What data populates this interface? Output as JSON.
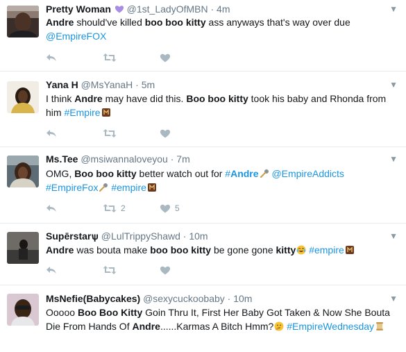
{
  "tweets": [
    {
      "name": "Pretty Woman",
      "name_emoji": "purple-heart",
      "handle": "@1st_LadyOfMBN",
      "time": "4m",
      "parts": [
        {
          "t": "Andre",
          "b": true
        },
        {
          "t": " should've killed "
        },
        {
          "t": "boo boo kitty",
          "b": true
        },
        {
          "t": " ass anyways that's way over due "
        },
        {
          "t": "@EmpireFOX",
          "link": true
        }
      ],
      "retweets": "",
      "likes": ""
    },
    {
      "name": "Yana H",
      "handle": "@MsYanaH",
      "time": "5m",
      "parts": [
        {
          "t": "I think "
        },
        {
          "t": "Andre",
          "b": true
        },
        {
          "t": " may have did this. "
        },
        {
          "t": "Boo boo kitty",
          "b": true
        },
        {
          "t": " took his baby and Rhonda from him  "
        },
        {
          "t": "#Empire",
          "link": true
        },
        {
          "emoji": "empire-logo"
        }
      ],
      "retweets": "",
      "likes": ""
    },
    {
      "name": "Ms.Tee",
      "handle": "@msiwannaloveyou",
      "time": "7m",
      "parts": [
        {
          "t": "OMG, "
        },
        {
          "t": "Boo boo kitty",
          "b": true
        },
        {
          "t": " better watch out for  "
        },
        {
          "t": "#",
          "link": true
        },
        {
          "t": "Andre",
          "b": true,
          "link": true
        },
        {
          "emoji": "microphone"
        },
        {
          "t": " "
        },
        {
          "t": "@EmpireAddicts",
          "link": true
        },
        {
          "t": " "
        },
        {
          "t": "#EmpireFox",
          "link": true
        },
        {
          "emoji": "microphone"
        },
        {
          "t": " "
        },
        {
          "t": "#empire",
          "link": true
        },
        {
          "emoji": "empire-logo"
        }
      ],
      "retweets": "2",
      "likes": "5"
    },
    {
      "name": "Supērstarѱ",
      "handle": "@LulTrippyShawd",
      "time": "10m",
      "parts": [
        {
          "t": "Andre",
          "b": true
        },
        {
          "t": " was bouta make "
        },
        {
          "t": "boo boo kitty",
          "b": true
        },
        {
          "t": " be gone gone "
        },
        {
          "t": "kitty",
          "b": true
        },
        {
          "emoji": "tears-of-joy"
        },
        {
          "t": " "
        },
        {
          "t": "#empire",
          "link": true
        },
        {
          "emoji": "empire-logo"
        }
      ],
      "retweets": "",
      "likes": ""
    },
    {
      "name": "MsNefie(Babycakes)",
      "handle": "@sexycuckoobaby",
      "time": "10m",
      "parts": [
        {
          "t": "Ooooo "
        },
        {
          "t": "Boo Boo Kitty",
          "b": true
        },
        {
          "t": " Goin Thru It, First Her Baby Got Taken & Now She Bouta Die From Hands Of "
        },
        {
          "t": "Andre",
          "b": true
        },
        {
          "t": "......Karmas A Bitch Hmm?"
        },
        {
          "emoji": "thinking"
        },
        {
          "t": " "
        },
        {
          "t": "#EmpireWednesday",
          "link": true
        },
        {
          "emoji": "scroll"
        }
      ],
      "retweets": "",
      "likes": ""
    }
  ],
  "colors": {
    "link": "#1b95e0",
    "text": "#14171a",
    "muted": "#657786",
    "icon": "#aab8c2",
    "divider": "#e6ecf0",
    "heart": "#ab8ce4"
  }
}
